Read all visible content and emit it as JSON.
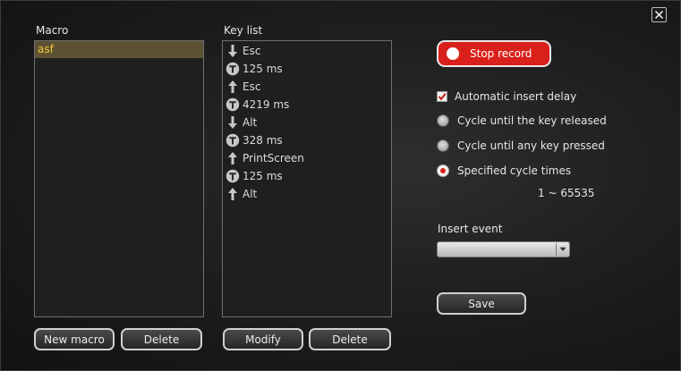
{
  "labels": {
    "macro": "Macro",
    "key_list": "Key list",
    "insert_event": "Insert event"
  },
  "macros": [
    {
      "name": "asf",
      "selected": true
    }
  ],
  "key_list": [
    {
      "type": "key-up",
      "icon": "arrow-down-icon",
      "text": "Esc"
    },
    {
      "type": "delay",
      "icon": "timer-icon",
      "text": "125 ms"
    },
    {
      "type": "key-down",
      "icon": "arrow-up-icon",
      "text": "Esc"
    },
    {
      "type": "delay",
      "icon": "timer-icon",
      "text": "4219 ms"
    },
    {
      "type": "key-up",
      "icon": "arrow-down-icon",
      "text": "Alt"
    },
    {
      "type": "delay",
      "icon": "timer-icon",
      "text": "328 ms"
    },
    {
      "type": "key-down",
      "icon": "arrow-up-icon",
      "text": "PrintScreen"
    },
    {
      "type": "delay",
      "icon": "timer-icon",
      "text": "125 ms"
    },
    {
      "type": "key-down",
      "icon": "arrow-up-icon",
      "text": "Alt"
    }
  ],
  "buttons": {
    "new_macro": "New macro",
    "delete_macro": "Delete",
    "modify": "Modify",
    "delete_key": "Delete",
    "stop_record": "Stop record",
    "save": "Save"
  },
  "options": {
    "auto_insert_delay": {
      "label": "Automatic insert delay",
      "checked": true
    },
    "cycle_modes": [
      {
        "label": "Cycle until the key released",
        "selected": false
      },
      {
        "label": "Cycle until any key pressed",
        "selected": false
      },
      {
        "label": "Specified cycle times",
        "selected": true
      }
    ],
    "cycle_range": "1 ~ 65535"
  },
  "insert_event": {
    "value": ""
  },
  "colors": {
    "accent_red": "#d9201b",
    "selection_bg": "#5c5131",
    "selection_text": "#f0c63a",
    "background": "#1c1c1c"
  }
}
